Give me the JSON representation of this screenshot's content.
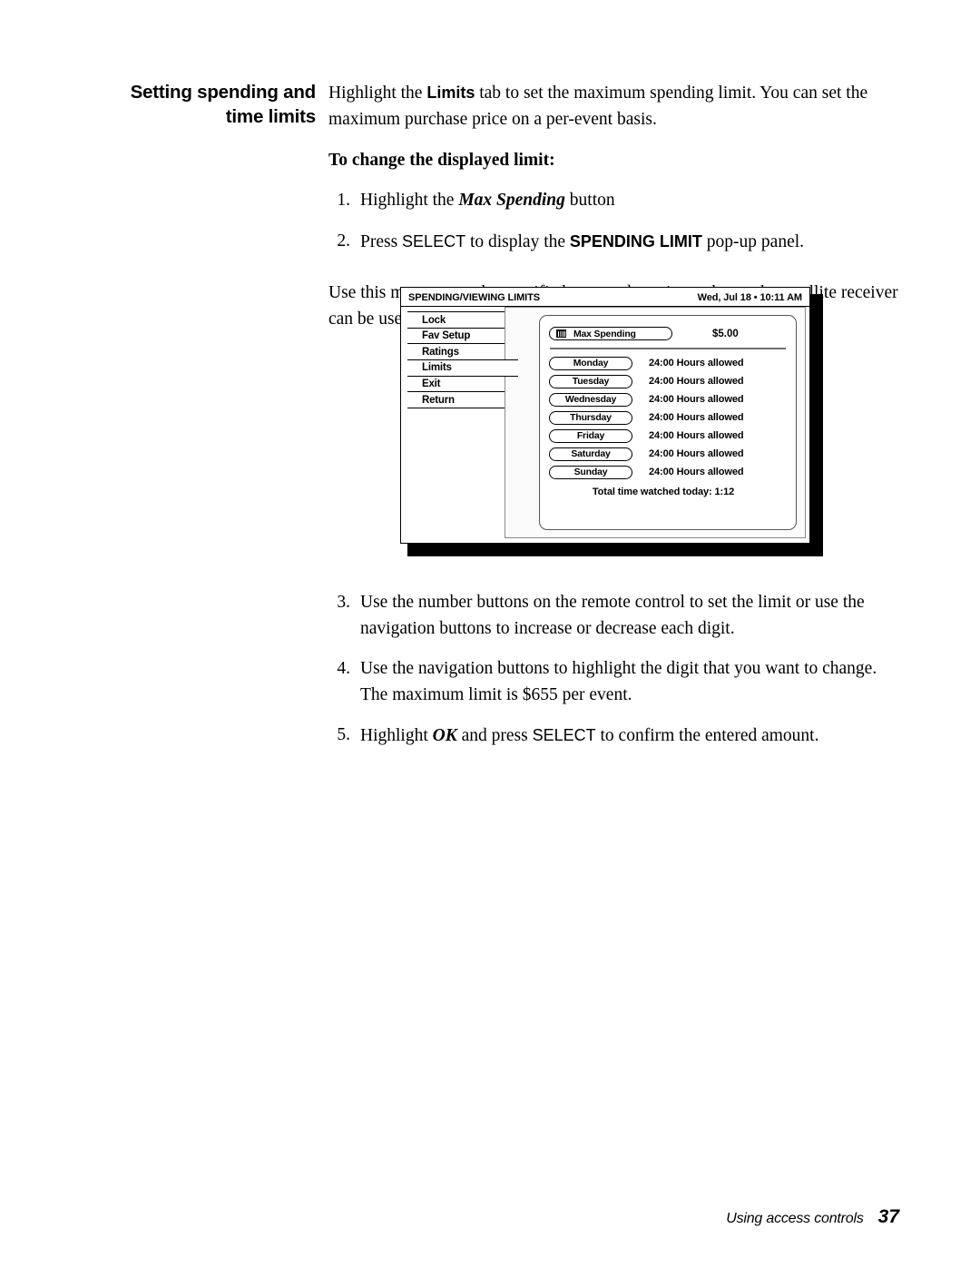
{
  "margin_heading": {
    "line1": "Setting spending and",
    "line2": "time limits"
  },
  "intro": {
    "part1": "Highlight the ",
    "bold1": "Limits",
    "part2": " tab to set the maximum spending limit. You can set the maximum purchase price on a per-event basis."
  },
  "subhead": "To change the displayed limit:",
  "steps_first": [
    {
      "num": "1.",
      "pre": "Highlight the ",
      "emph": "Max Spending",
      "post": " button"
    },
    {
      "num": "2.",
      "pre": "Press ",
      "emph": "SELECT",
      "mid": " to display the ",
      "emph2": "SPENDING LIMIT",
      "post": " pop-up panel."
    }
  ],
  "mid_para": "Use this menu to set the specific hours and maximum hours the satellite receiver can be used for viewing.",
  "steps_last": [
    {
      "num": "3.",
      "text": "Use the number buttons on the remote control to set the limit or use the navigation buttons to increase or decrease each digit."
    },
    {
      "num": "4.",
      "text": "Use the navigation buttons to highlight the digit that you want to change. The maximum limit is $655 per event."
    },
    {
      "num": "5.",
      "pre": "Highlight ",
      "emph": "OK",
      "mid": " and press ",
      "emph2": "SELECT",
      "post": " to confirm the entered amount."
    }
  ],
  "tv_screen": {
    "title": "SPENDING/VIEWING LIMITS",
    "clock": "Wed, Jul 18 • 10:11 AM",
    "tabs": [
      {
        "label": "Lock",
        "selected": false
      },
      {
        "label": "Fav Setup",
        "selected": false
      },
      {
        "label": "Ratings",
        "selected": false
      },
      {
        "label": "Limits",
        "selected": true
      },
      {
        "label": "Exit",
        "selected": false
      },
      {
        "label": "Return",
        "selected": false
      }
    ],
    "max_spending": {
      "icon": "keypad-icon",
      "label": "Max Spending",
      "value": "$5.00"
    },
    "days": [
      {
        "label": "Monday",
        "hours": "24:00 Hours allowed"
      },
      {
        "label": "Tuesday",
        "hours": "24:00 Hours allowed"
      },
      {
        "label": "Wednesday",
        "hours": "24:00 Hours allowed"
      },
      {
        "label": "Thursday",
        "hours": "24:00 Hours allowed"
      },
      {
        "label": "Friday",
        "hours": "24:00 Hours allowed"
      },
      {
        "label": "Saturday",
        "hours": "24:00 Hours allowed"
      },
      {
        "label": "Sunday",
        "hours": "24:00 Hours allowed"
      }
    ],
    "total_label": "Total time watched today:  1:12"
  },
  "footer": {
    "chapter": "Using access controls",
    "page": "37"
  },
  "colors": {
    "text": "#000000",
    "bezel": "#000000",
    "panel_bg": "#fbfbfb",
    "divider": "#6f6f6f"
  }
}
